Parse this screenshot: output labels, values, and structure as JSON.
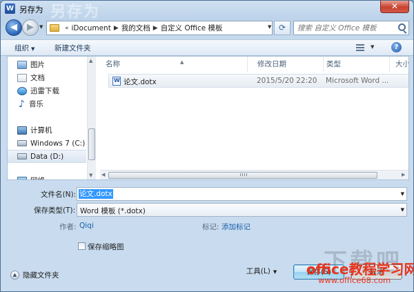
{
  "window": {
    "title": "另存为",
    "app_icon_label": "W",
    "ghost_title": "另存为",
    "close_glyph": "✕"
  },
  "nav": {
    "back_glyph": "◀",
    "forward_glyph": "▶",
    "breadcrumbs": [
      "iDocument",
      "我的文档",
      "自定义 Office 模板"
    ],
    "refresh_glyph": "⟳",
    "search_placeholder": "搜索 自定义 Office 模板"
  },
  "toolbar": {
    "organize_label": "组织",
    "new_folder_label": "新建文件夹"
  },
  "sidebar": {
    "items": [
      {
        "label": "图片",
        "icon": "pictures-icon"
      },
      {
        "label": "文档",
        "icon": "documents-icon"
      },
      {
        "label": "迅雷下载",
        "icon": "downloads-icon"
      },
      {
        "label": "音乐",
        "icon": "music-icon"
      },
      {
        "label": "计算机",
        "icon": "computer-icon"
      },
      {
        "label": "Windows 7 (C:)",
        "icon": "drive-icon"
      },
      {
        "label": "Data (D:)",
        "icon": "drive-icon",
        "selected": true
      },
      {
        "label": "网络",
        "icon": "network-icon"
      }
    ]
  },
  "files": {
    "columns": [
      "名称",
      "修改日期",
      "类型",
      "大小"
    ],
    "rows": [
      {
        "name": "论文.dotx",
        "modified": "2015/5/20 22:20",
        "type": "Microsoft Word ..."
      }
    ]
  },
  "form": {
    "filename_label": "文件名(N):",
    "filename_value": "论文.dotx",
    "savetype_label": "保存类型(T):",
    "savetype_value": "Word 模板 (*.dotx)",
    "author_label": "作者:",
    "author_value": "Qiqi",
    "tags_label": "标记:",
    "tags_value": "添加标记",
    "thumbnail_label": "保存缩略图"
  },
  "footer": {
    "hide_folders_label": "隐藏文件夹",
    "tools_label": "工具(L)",
    "save_label": "保存(S)",
    "cancel_label": "取消"
  },
  "watermark": {
    "ghost": "下载吧",
    "main": "office教程学习网",
    "url": "www.office68.com"
  },
  "colors": {
    "accent": "#3399ff",
    "watermark": "#e8341c",
    "link": "#1a5ea8"
  }
}
